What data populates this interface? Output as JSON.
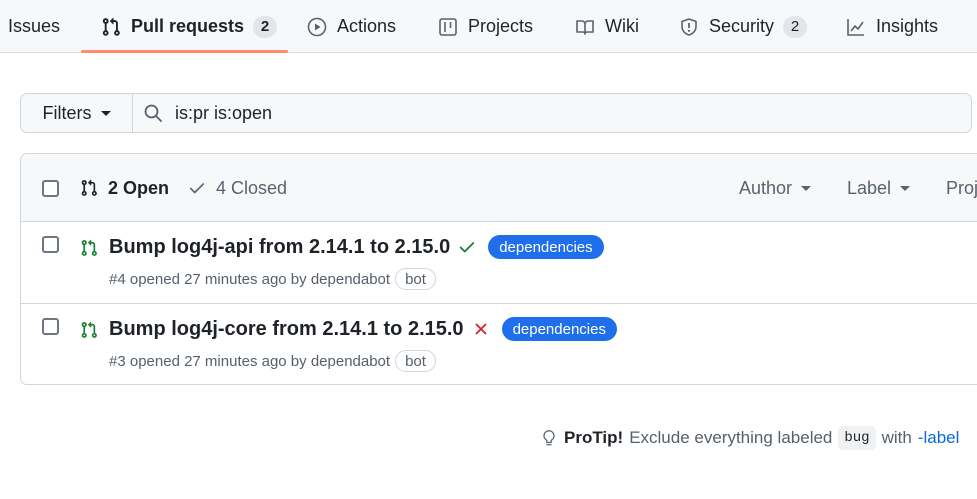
{
  "nav": {
    "tabs": [
      {
        "label": "Issues",
        "icon": "issue-icon"
      },
      {
        "label": "Pull requests",
        "counter": "2",
        "icon": "git-pull-request-icon",
        "selected": true
      },
      {
        "label": "Actions",
        "icon": "play-icon"
      },
      {
        "label": "Projects",
        "icon": "table-icon"
      },
      {
        "label": "Wiki",
        "icon": "book-icon"
      },
      {
        "label": "Security",
        "counter": "2",
        "icon": "shield-icon"
      },
      {
        "label": "Insights",
        "icon": "graph-icon"
      }
    ]
  },
  "filters": {
    "button_label": "Filters",
    "search_value": "is:pr is:open"
  },
  "list": {
    "open_label": "2 Open",
    "closed_label": "4 Closed",
    "author_label": "Author",
    "label_label": "Label",
    "projects_label": "Proj",
    "rows": [
      {
        "title": "Bump log4j-api from 2.14.1 to 2.15.0",
        "status": "success",
        "label": "dependencies",
        "meta": "#4 opened 27 minutes ago by dependabot",
        "bot": "bot"
      },
      {
        "title": "Bump log4j-core from 2.14.1 to 2.15.0",
        "status": "failure",
        "label": "dependencies",
        "meta": "#3 opened 27 minutes ago by dependabot",
        "bot": "bot"
      }
    ]
  },
  "protip": {
    "title": "ProTip!",
    "text": "Exclude everything labeled",
    "code": "bug",
    "with": "with",
    "link": "-label"
  },
  "colors": {
    "accent_underline": "#fd8c73",
    "label_blue": "#1f6feb",
    "open_green": "#1a7f37",
    "fail_red": "#cf222e",
    "link_blue": "#0969da"
  }
}
